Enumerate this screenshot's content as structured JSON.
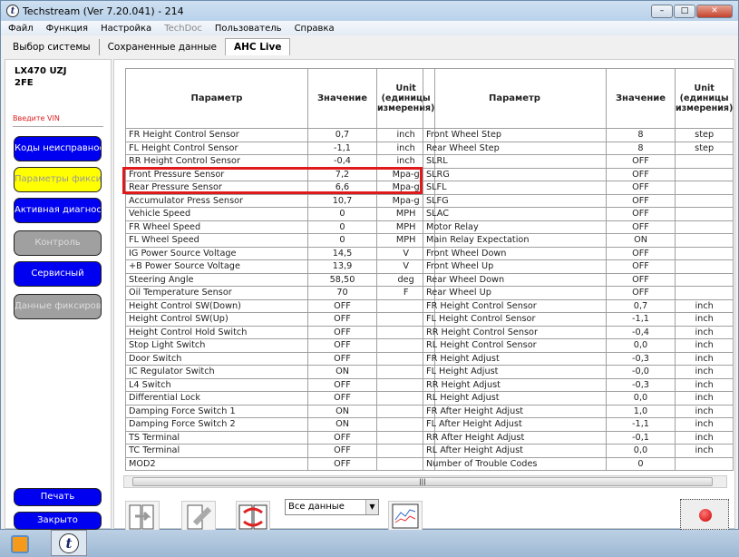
{
  "window": {
    "title": "Techstream (Ver 7.20.041) - 214"
  },
  "menu": [
    "Файл",
    "Функция",
    "Настройка",
    "TechDoc",
    "Пользователь",
    "Справка"
  ],
  "tabs": [
    "Выбор системы",
    "Сохраненные данные",
    "AHC Live"
  ],
  "vehicle": {
    "model": "LX470 UZJ",
    "engine": "2FE",
    "vin_prompt": "Введите VIN"
  },
  "left_buttons": [
    "Коды неисправности",
    "Параметры фиксированного",
    "Активная диагностика",
    "Контроль",
    "Сервисный",
    "Данные фиксированного"
  ],
  "bottom_buttons": {
    "print": "Печать",
    "close": "Закрыто"
  },
  "headers": {
    "param": "Параметр",
    "value": "Значение",
    "unit": "Unit (единицы измерения)"
  },
  "left_rows": [
    [
      "FR Height Control Sensor",
      "0,7",
      "inch"
    ],
    [
      "FL Height Control Sensor",
      "-1,1",
      "inch"
    ],
    [
      "RR Height Control Sensor",
      "-0,4",
      "inch"
    ],
    [
      "Front Pressure Sensor",
      "7,2",
      "Mpa-g"
    ],
    [
      "Rear Pressure Sensor",
      "6,6",
      "Mpa-g"
    ],
    [
      "Accumulator Press Sensor",
      "10,7",
      "Mpa-g"
    ],
    [
      "Vehicle Speed",
      "0",
      "MPH"
    ],
    [
      "FR Wheel Speed",
      "0",
      "MPH"
    ],
    [
      "FL Wheel Speed",
      "0",
      "MPH"
    ],
    [
      "IG Power Source Voltage",
      "14,5",
      "V"
    ],
    [
      "+B Power Source Voltage",
      "13,9",
      "V"
    ],
    [
      "Steering Angle",
      "58,50",
      "deg"
    ],
    [
      "Oil Temperature Sensor",
      "70",
      "F"
    ],
    [
      "Height Control SW(Down)",
      "OFF",
      ""
    ],
    [
      "Height Control SW(Up)",
      "OFF",
      ""
    ],
    [
      "Height Control Hold Switch",
      "OFF",
      ""
    ],
    [
      "Stop Light Switch",
      "OFF",
      ""
    ],
    [
      "Door Switch",
      "OFF",
      ""
    ],
    [
      "IC Regulator Switch",
      "ON",
      ""
    ],
    [
      "L4 Switch",
      "OFF",
      ""
    ],
    [
      "Differential Lock",
      "OFF",
      ""
    ],
    [
      "Damping Force Switch 1",
      "ON",
      ""
    ],
    [
      "Damping Force Switch 2",
      "ON",
      ""
    ],
    [
      "TS Terminal",
      "OFF",
      ""
    ],
    [
      "TC Terminal",
      "OFF",
      ""
    ],
    [
      "MOD2",
      "OFF",
      ""
    ]
  ],
  "right_rows": [
    [
      "Front Wheel Step",
      "8",
      "step"
    ],
    [
      "Rear Wheel Step",
      "8",
      "step"
    ],
    [
      "SLRL",
      "OFF",
      ""
    ],
    [
      "SLRG",
      "OFF",
      ""
    ],
    [
      "SLFL",
      "OFF",
      ""
    ],
    [
      "SLFG",
      "OFF",
      ""
    ],
    [
      "SLAC",
      "OFF",
      ""
    ],
    [
      "Motor Relay",
      "OFF",
      ""
    ],
    [
      "Main Relay Expectation",
      "ON",
      ""
    ],
    [
      "Front Wheel Down",
      "OFF",
      ""
    ],
    [
      "Front Wheel Up",
      "OFF",
      ""
    ],
    [
      "Rear Wheel Down",
      "OFF",
      ""
    ],
    [
      "Rear Wheel Up",
      "OFF",
      ""
    ],
    [
      "FR Height Control Sensor",
      "0,7",
      "inch"
    ],
    [
      "FL Height Control Sensor",
      "-1,1",
      "inch"
    ],
    [
      "RR Height Control Sensor",
      "-0,4",
      "inch"
    ],
    [
      "RL Height Control Sensor",
      "0,0",
      "inch"
    ],
    [
      "FR Height Adjust",
      "-0,3",
      "inch"
    ],
    [
      "FL Height Adjust",
      "-0,0",
      "inch"
    ],
    [
      "RR Height Adjust",
      "-0,3",
      "inch"
    ],
    [
      "RL Height Adjust",
      "0,0",
      "inch"
    ],
    [
      "FR After Height Adjust",
      "1,0",
      "inch"
    ],
    [
      "FL After Height Adjust",
      "-1,1",
      "inch"
    ],
    [
      "RR After Height Adjust",
      "-0,1",
      "inch"
    ],
    [
      "RL After Height Adjust",
      "0,0",
      "inch"
    ],
    [
      "Number of Trouble Codes",
      "0",
      ""
    ]
  ],
  "toolbar": {
    "filter": "Все данные"
  }
}
